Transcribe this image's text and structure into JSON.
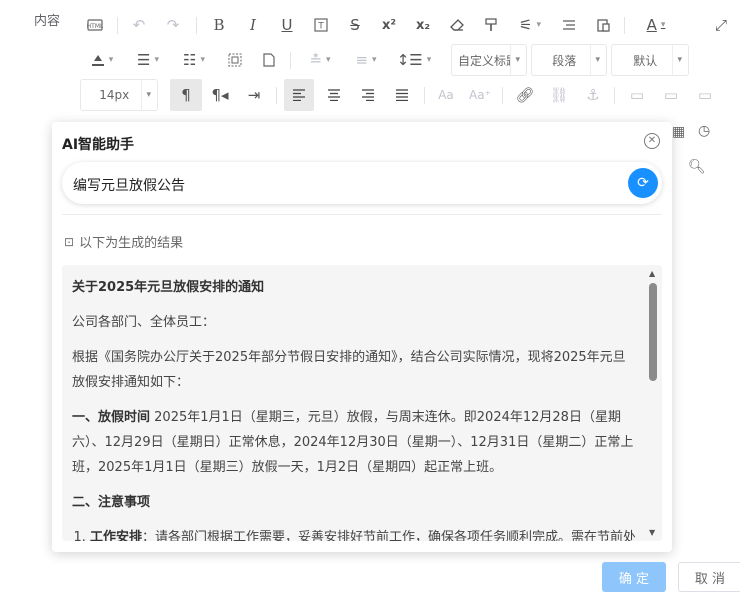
{
  "form": {
    "content_label": "内容"
  },
  "toolbar": {
    "font_size": "14px",
    "heading_style": "自定义标题",
    "paragraph": "段落",
    "font_family": "默认"
  },
  "dialog": {
    "title": "AI智能助手",
    "prompt_value": "编写元旦放假公告",
    "result_hint": "以下为生成的结果",
    "result": {
      "heading": "关于2025年元旦放假安排的通知",
      "salutation": "公司各部门、全体员工：",
      "intro": "根据《国务院办公厅关于2025年部分节假日安排的通知》，结合公司实际情况，现将2025年元旦放假安排通知如下：",
      "sec1_label": "一、放假时间",
      "sec1_text": "2025年1月1日（星期三，元旦）放假，与周末连休。即2024年12月28日（星期六）、12月29日（星期日）正常休息，2024年12月30日（星期一）、12月31日（星期二）正常上班，2025年1月1日（星期三）放假一天，1月2日（星期四）起正常上班。",
      "sec2_label": "二、注意事项",
      "item1_label": "工作安排",
      "item1_text": "：请各部门根据工作需要，妥善安排好节前工作，确保各项任务顺利完成。需在节前处理完毕的紧急事务，请提前做好沟通与交接。"
    }
  },
  "footer": {
    "confirm_label": "确 定",
    "cancel_label": "取 消"
  },
  "colors": {
    "primary": "#1890ff",
    "confirm_disabled": "#8ec5fb"
  }
}
